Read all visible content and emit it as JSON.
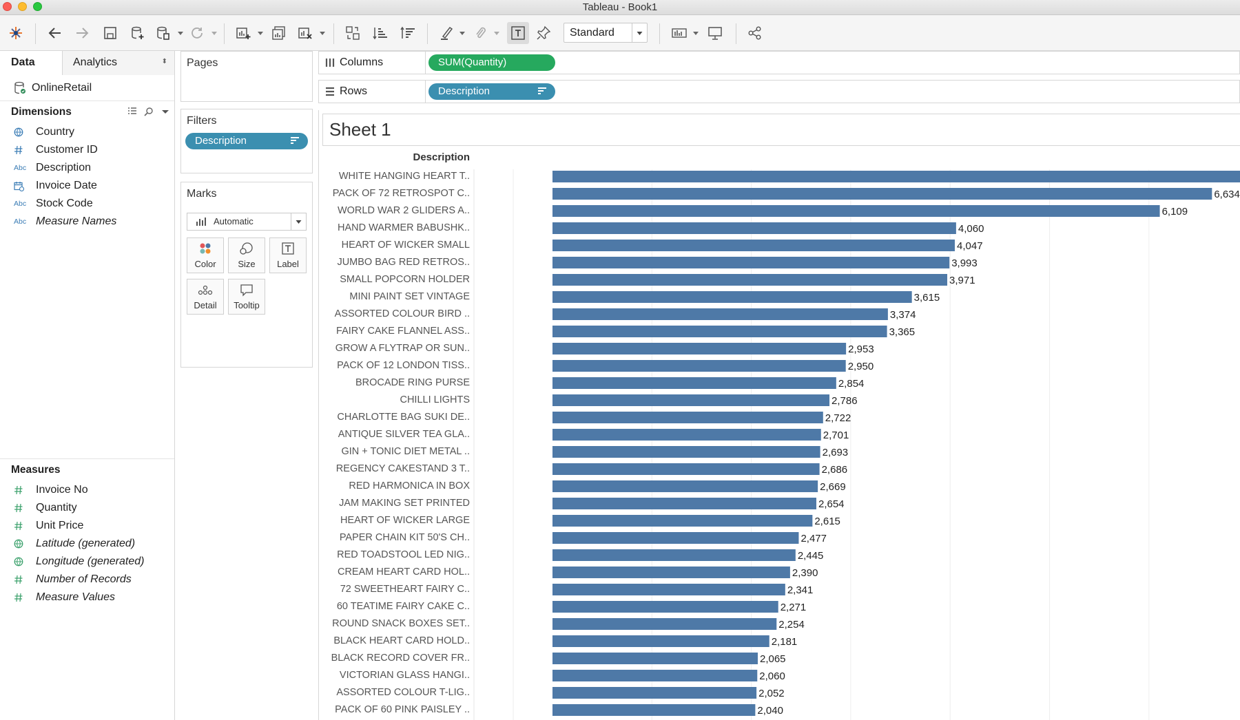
{
  "window": {
    "title": "Tableau - Book1"
  },
  "colors": {
    "bar": "#4e79a7",
    "pill_blue": "#3b8fb0",
    "pill_green": "#26a95e"
  },
  "toolbar": {
    "view_size": "Standard"
  },
  "datapane": {
    "tabs": [
      "Data",
      "Analytics"
    ],
    "datasource": "OnlineRetail",
    "dimensions_title": "Dimensions",
    "dimensions": [
      {
        "icon": "globe-icon",
        "label": "Country",
        "italic": false
      },
      {
        "icon": "hash-icon",
        "label": "Customer ID",
        "italic": false
      },
      {
        "icon": "abc-icon",
        "label": "Description",
        "italic": false
      },
      {
        "icon": "calendar-icon",
        "label": "Invoice Date",
        "italic": false
      },
      {
        "icon": "abc-icon",
        "label": "Stock Code",
        "italic": false
      },
      {
        "icon": "abc-icon",
        "label": "Measure Names",
        "italic": true
      }
    ],
    "measures_title": "Measures",
    "measures": [
      {
        "icon": "hash-icon",
        "label": "Invoice No",
        "italic": false
      },
      {
        "icon": "hash-icon",
        "label": "Quantity",
        "italic": false
      },
      {
        "icon": "hash-icon",
        "label": "Unit Price",
        "italic": false
      },
      {
        "icon": "globe-icon",
        "label": "Latitude (generated)",
        "italic": true
      },
      {
        "icon": "globe-icon",
        "label": "Longitude (generated)",
        "italic": true
      },
      {
        "icon": "hash-icon",
        "label": "Number of Records",
        "italic": true
      },
      {
        "icon": "hash-icon",
        "label": "Measure Values",
        "italic": true
      }
    ]
  },
  "cards": {
    "pages_title": "Pages",
    "filters_title": "Filters",
    "filter_pill": "Description",
    "marks_title": "Marks",
    "mark_type": "Automatic",
    "mark_buttons": [
      "Color",
      "Size",
      "Label",
      "Detail",
      "Tooltip"
    ]
  },
  "shelves": {
    "columns_label": "Columns",
    "columns_pill": "SUM(Quantity)",
    "rows_label": "Rows",
    "rows_pill": "Description"
  },
  "sheet": {
    "title": "Sheet 1"
  },
  "chart_data": {
    "type": "bar",
    "orientation": "horizontal",
    "row_header": "Description",
    "xlim": [
      0,
      7200
    ],
    "categories": [
      "WHITE HANGING HEART T..",
      "PACK OF 72 RETROSPOT C..",
      "WORLD WAR 2 GLIDERS A..",
      "HAND WARMER BABUSHK..",
      "HEART OF WICKER SMALL",
      "JUMBO BAG RED RETROS..",
      "SMALL POPCORN HOLDER",
      "MINI PAINT SET VINTAGE",
      "ASSORTED COLOUR BIRD ..",
      "FAIRY CAKE FLANNEL ASS..",
      "GROW A FLYTRAP OR SUN..",
      "PACK OF 12 LONDON TISS..",
      "BROCADE RING PURSE",
      "CHILLI LIGHTS",
      "CHARLOTTE BAG SUKI DE..",
      "ANTIQUE SILVER TEA GLA..",
      "GIN + TONIC DIET METAL ..",
      "REGENCY CAKESTAND 3 T..",
      "RED  HARMONICA IN BOX",
      "JAM MAKING SET PRINTED",
      "HEART OF WICKER LARGE",
      "PAPER CHAIN KIT 50'S CH..",
      "RED TOADSTOOL LED NIG..",
      "CREAM HEART CARD HOL..",
      "72 SWEETHEART FAIRY C..",
      "60 TEATIME FAIRY CAKE C..",
      "ROUND SNACK BOXES SET..",
      "BLACK HEART CARD HOLD..",
      "BLACK RECORD COVER FR..",
      "VICTORIAN GLASS HANGI..",
      "ASSORTED COLOUR T-LIG..",
      "PACK OF 60 PINK PAISLEY .."
    ],
    "values": [
      7350,
      6634,
      6109,
      4060,
      4047,
      3993,
      3971,
      3615,
      3374,
      3365,
      2953,
      2950,
      2854,
      2786,
      2722,
      2701,
      2693,
      2686,
      2669,
      2654,
      2615,
      2477,
      2445,
      2390,
      2341,
      2271,
      2254,
      2181,
      2065,
      2060,
      2052,
      2040
    ],
    "value_labels": [
      "",
      "6,634",
      "6,109",
      "4,060",
      "4,047",
      "3,993",
      "3,971",
      "3,615",
      "3,374",
      "3,365",
      "2,953",
      "2,950",
      "2,854",
      "2,786",
      "2,722",
      "2,701",
      "2,693",
      "2,686",
      "2,669",
      "2,654",
      "2,615",
      "2,477",
      "2,445",
      "2,390",
      "2,341",
      "2,271",
      "2,254",
      "2,181",
      "2,065",
      "2,060",
      "2,052",
      "2,040"
    ]
  }
}
